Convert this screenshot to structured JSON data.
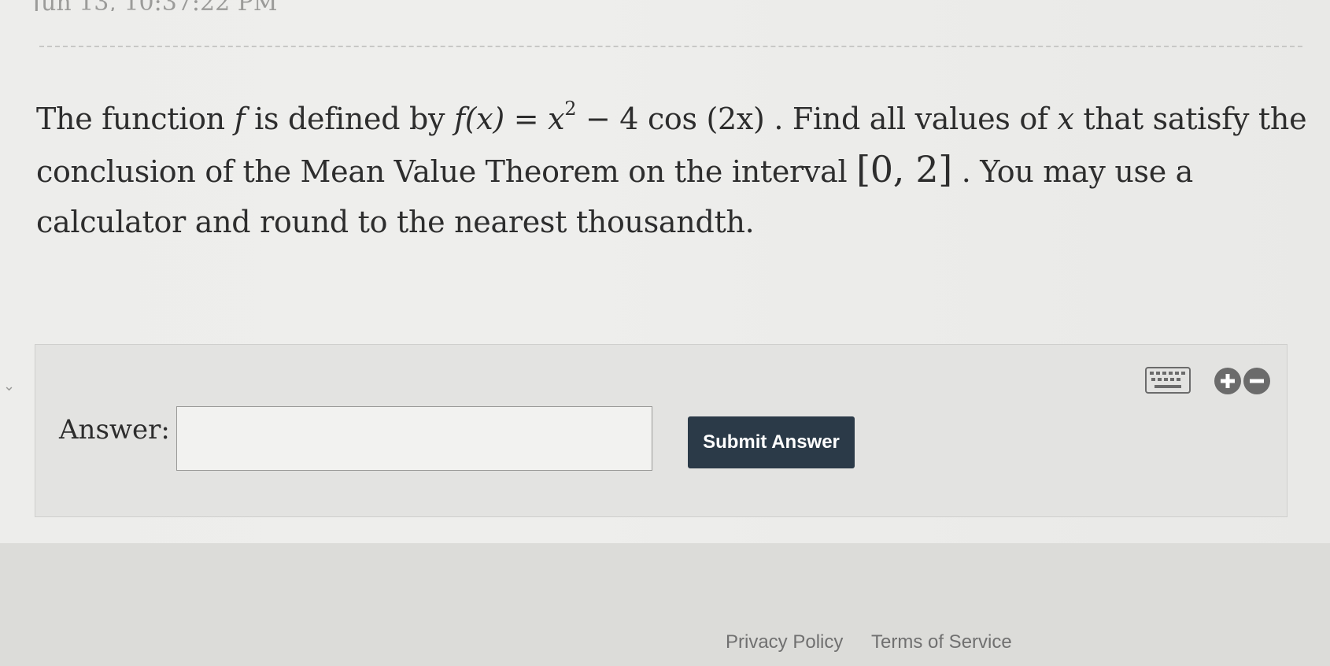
{
  "header": {
    "timestamp_partial": "Jun 13, 10:37:22 PM"
  },
  "question": {
    "t1": "The function ",
    "f": "f",
    "t2": " is defined by ",
    "expr_lhs": "f(x)",
    "expr_eq": " = ",
    "expr_x": "x",
    "expr_exp": "2",
    "expr_rest": " − 4 cos (2x)",
    "t3": " . Find all values of ",
    "x": "x",
    "t4": " that satisfy the conclusion of the Mean Value Theorem on the interval ",
    "interval": "[0, 2]",
    "t5": " . You may use a calculator and round to the nearest thousandth."
  },
  "answer": {
    "label": "Answer:",
    "value": "",
    "submit_label": "Submit Answer"
  },
  "icons": [
    "keyboard-icon",
    "plus-circle-icon",
    "minus-circle-icon"
  ],
  "colors": {
    "submit_bg": "#2b3a48",
    "icon_fill": "#6b6b6b"
  },
  "footer": {
    "privacy": "Privacy Policy",
    "terms": "Terms of Service"
  }
}
